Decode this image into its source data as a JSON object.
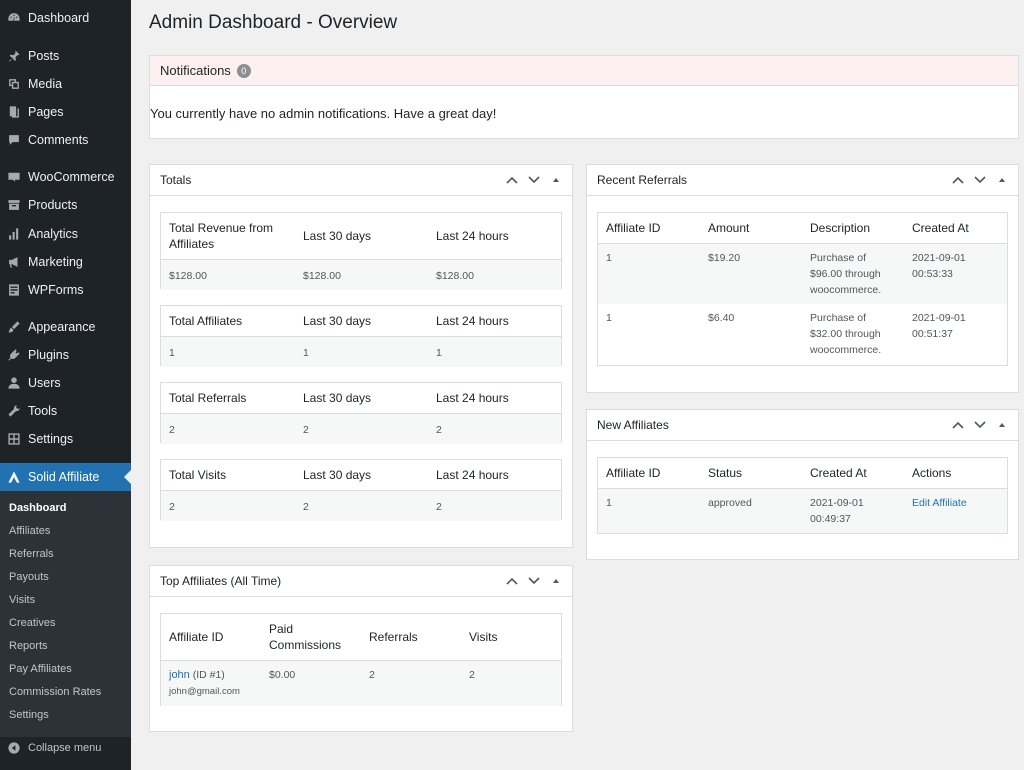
{
  "sidebar": {
    "items": [
      {
        "label": "Dashboard",
        "icon": "dashboard-icon"
      },
      {
        "label": "Posts",
        "icon": "pin-icon"
      },
      {
        "label": "Media",
        "icon": "media-icon"
      },
      {
        "label": "Pages",
        "icon": "pages-icon"
      },
      {
        "label": "Comments",
        "icon": "comment-icon"
      },
      {
        "label": "WooCommerce",
        "icon": "woo-icon"
      },
      {
        "label": "Products",
        "icon": "archive-icon"
      },
      {
        "label": "Analytics",
        "icon": "chart-icon"
      },
      {
        "label": "Marketing",
        "icon": "megaphone-icon"
      },
      {
        "label": "WPForms",
        "icon": "forms-icon"
      },
      {
        "label": "Appearance",
        "icon": "brush-icon"
      },
      {
        "label": "Plugins",
        "icon": "plug-icon"
      },
      {
        "label": "Users",
        "icon": "user-icon"
      },
      {
        "label": "Tools",
        "icon": "wrench-icon"
      },
      {
        "label": "Settings",
        "icon": "settings-icon"
      },
      {
        "label": "Solid Affiliate",
        "icon": "solid-affiliate-icon"
      }
    ],
    "submenu": [
      "Dashboard",
      "Affiliates",
      "Referrals",
      "Payouts",
      "Visits",
      "Creatives",
      "Reports",
      "Pay Affiliates",
      "Commission Rates",
      "Settings"
    ],
    "collapse_label": "Collapse menu"
  },
  "page": {
    "title": "Admin Dashboard - Overview"
  },
  "notifications": {
    "title": "Notifications",
    "count": "0",
    "message": "You currently have no admin notifications. Have a great day!"
  },
  "totals": {
    "title": "Totals",
    "tables": [
      {
        "headers": [
          "Total Revenue from Affiliates",
          "Last 30 days",
          "Last 24 hours"
        ],
        "values": [
          "$128.00",
          "$128.00",
          "$128.00"
        ]
      },
      {
        "headers": [
          "Total Affiliates",
          "Last 30 days",
          "Last 24 hours"
        ],
        "values": [
          "1",
          "1",
          "1"
        ]
      },
      {
        "headers": [
          "Total Referrals",
          "Last 30 days",
          "Last 24 hours"
        ],
        "values": [
          "2",
          "2",
          "2"
        ]
      },
      {
        "headers": [
          "Total Visits",
          "Last 30 days",
          "Last 24 hours"
        ],
        "values": [
          "2",
          "2",
          "2"
        ]
      }
    ]
  },
  "top_affiliates": {
    "title": "Top Affiliates (All Time)",
    "headers": [
      "Affiliate ID",
      "Paid Commissions",
      "Referrals",
      "Visits"
    ],
    "rows": [
      {
        "name": "john",
        "id_text": "(ID #1)",
        "email": "john@gmail.com",
        "paid": "$0.00",
        "referrals": "2",
        "visits": "2"
      }
    ]
  },
  "recent_referrals": {
    "title": "Recent Referrals",
    "headers": [
      "Affiliate ID",
      "Amount",
      "Description",
      "Created At"
    ],
    "rows": [
      {
        "affiliate_id": "1",
        "amount": "$19.20",
        "description": "Purchase of $96.00 through woocommerce.",
        "created_date": "2021-09-01",
        "created_time": "00:53:33"
      },
      {
        "affiliate_id": "1",
        "amount": "$6.40",
        "description": "Purchase of $32.00 through woocommerce.",
        "created_date": "2021-09-01",
        "created_time": "00:51:37"
      }
    ]
  },
  "new_affiliates": {
    "title": "New Affiliates",
    "headers": [
      "Affiliate ID",
      "Status",
      "Created At",
      "Actions"
    ],
    "rows": [
      {
        "affiliate_id": "1",
        "status": "approved",
        "created_date": "2021-09-01",
        "created_time": "00:49:37",
        "action": "Edit Affiliate"
      }
    ]
  },
  "colors": {
    "sidebar_bg": "#1d2327",
    "active": "#2271b1",
    "submenu_bg": "#2c3338",
    "notice_bg": "#fcf0f1",
    "link": "#2271b1"
  }
}
